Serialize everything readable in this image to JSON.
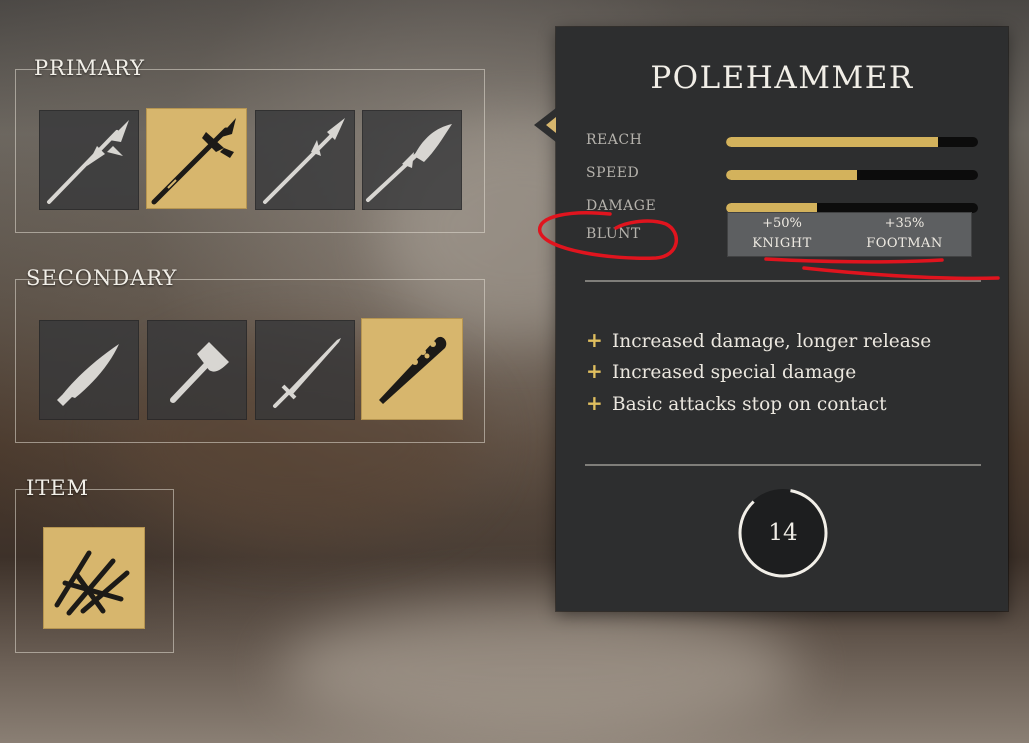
{
  "sections": {
    "primary_title": "PRIMARY",
    "secondary_title": "SECONDARY",
    "item_title": "ITEM"
  },
  "primary_slots": [
    {
      "icon": "halberd-icon",
      "selected": false
    },
    {
      "icon": "polehammer-icon",
      "selected": true
    },
    {
      "icon": "spear-icon",
      "selected": false
    },
    {
      "icon": "glaive-icon",
      "selected": false
    }
  ],
  "secondary_slots": [
    {
      "icon": "knife-icon",
      "selected": false
    },
    {
      "icon": "hatchet-icon",
      "selected": false
    },
    {
      "icon": "sword-icon",
      "selected": false
    },
    {
      "icon": "spiked-club-icon",
      "selected": true
    }
  ],
  "item_slot": {
    "icon": "caltrops-icon",
    "selected": true
  },
  "weapon": {
    "name": "POLEHAMMER",
    "stats": [
      {
        "label": "REACH",
        "value": 0.84
      },
      {
        "label": "SPEED",
        "value": 0.52
      },
      {
        "label": "DAMAGE",
        "value": 0.36
      }
    ],
    "damage_type_label": "BLUNT",
    "bonuses": [
      {
        "percent": "+50%",
        "target": "KNIGHT"
      },
      {
        "percent": "+35%",
        "target": "FOOTMAN"
      }
    ],
    "traits": [
      "Increased damage, longer release",
      "Increased special damage",
      "Basic attacks stop on contact"
    ],
    "cost": "14"
  },
  "colors": {
    "accent_gold": "#d7b66d",
    "bar_fill": "#d3b25c",
    "panel_bg": "#2d2e2f",
    "annotation_red": "#e0141e"
  }
}
